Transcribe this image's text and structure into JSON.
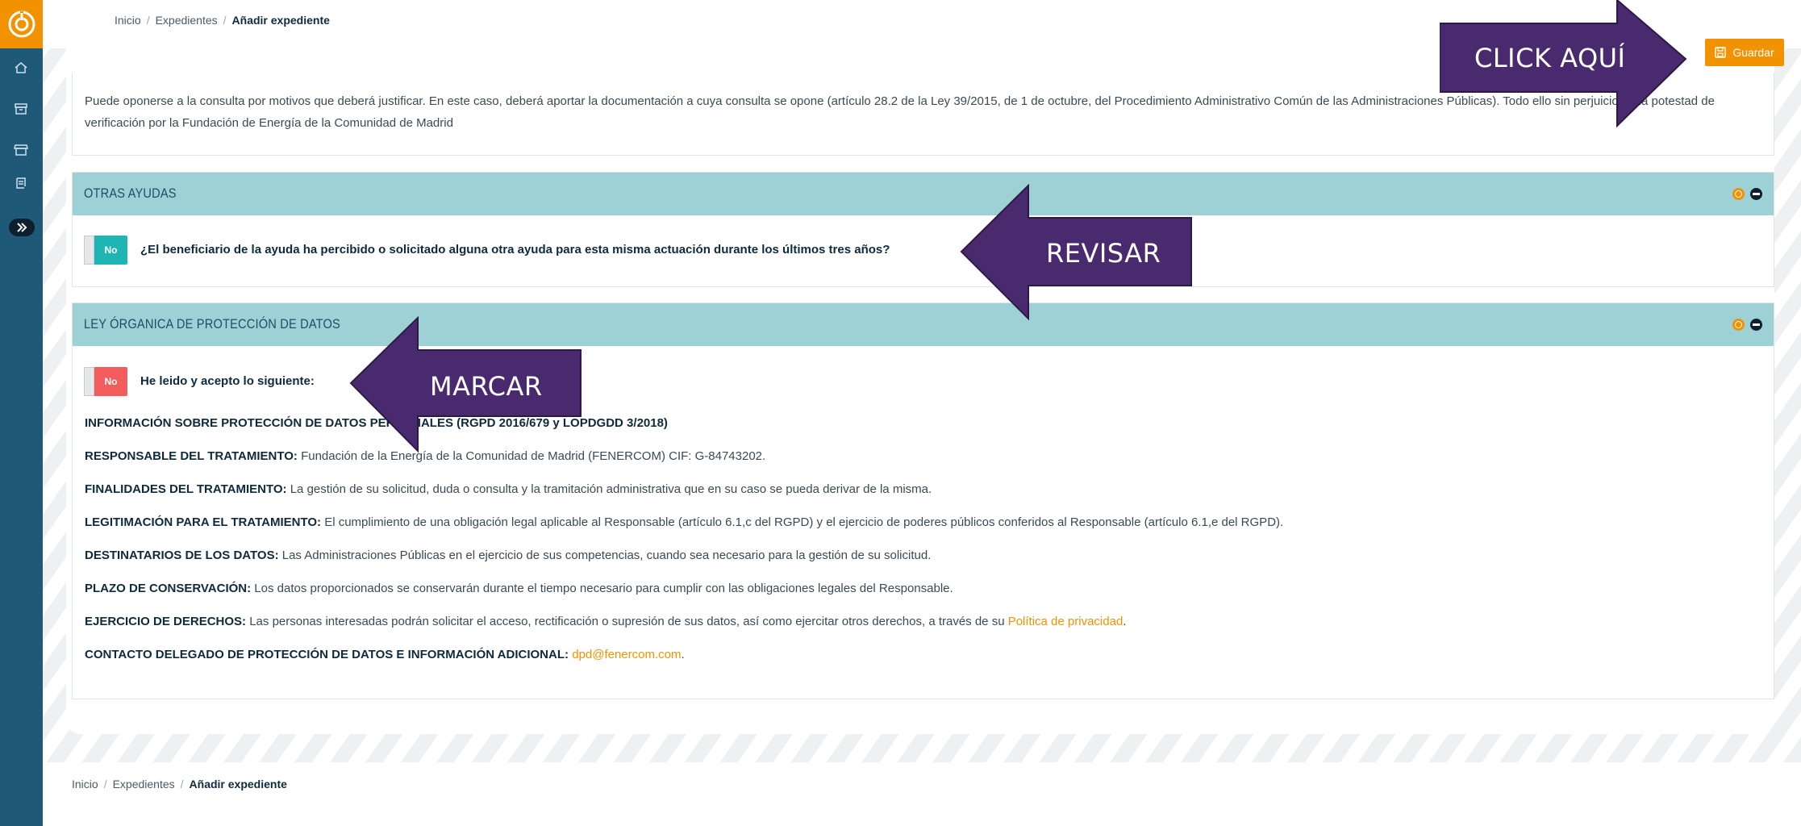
{
  "breadcrumb": {
    "home": "Inicio",
    "section": "Expedientes",
    "current": "Añadir expediente",
    "sep": "/"
  },
  "header": {
    "save_label": "Guardar"
  },
  "intro": {
    "text": "Puede oponerse a la consulta por motivos que deberá justificar. En este caso, deberá aportar la documentación a cuya consulta se opone (artículo 28.2 de la Ley 39/2015, de 1 de octubre, del Procedimiento Administrativo Común de las Administraciones Públicas). Todo ello sin perjuicio de la potestad de verificación por la Fundación de Energía de la Comunidad de Madrid"
  },
  "otras_ayudas": {
    "title": "OTRAS AYUDAS",
    "toggle_label": "No",
    "question": "¿El beneficiario de la ayuda ha percibido o solicitado alguna otra ayuda para esta misma actuación durante los últimos tres años?"
  },
  "lopd": {
    "title": "LEY ÓRGANICA DE PROTECCIÓN DE DATOS",
    "toggle_label": "No",
    "accept_text": "He leido y acepto lo siguiente:",
    "info_title": "INFORMACIÓN SOBRE PROTECCIÓN DE DATOS PERSONALES (RGPD 2016/679 y LOPDGDD 3/2018)",
    "lines": [
      {
        "label": "RESPONSABLE DEL TRATAMIENTO:",
        "text": " Fundación de la Energía de la Comunidad de Madrid (FENERCOM) CIF: G-84743202."
      },
      {
        "label": "FINALIDADES DEL TRATAMIENTO:",
        "text": " La gestión de su solicitud, duda o consulta y la tramitación administrativa que en su caso se pueda derivar de la misma."
      },
      {
        "label": "LEGITIMACIÓN PARA EL TRATAMIENTO:",
        "text": " El cumplimiento de una obligación legal aplicable al Responsable (artículo 6.1,c del RGPD) y el ejercicio de poderes públicos conferidos al Responsable (artículo 6.1,e del RGPD)."
      },
      {
        "label": "DESTINATARIOS DE LOS DATOS:",
        "text": " Las Administraciones Públicas en el ejercicio de sus competencias, cuando sea necesario para la gestión de su solicitud."
      },
      {
        "label": "PLAZO DE CONSERVACIÓN:",
        "text": " Los datos proporcionados se conservarán durante el tiempo necesario para cumplir con las obligaciones legales del Responsable."
      }
    ],
    "derechos": {
      "label": "EJERCICIO DE DERECHOS:",
      "text": " Las personas interesadas podrán solicitar el acceso, rectificación o supresión de sus datos, así como ejercitar otros derechos, a través de su ",
      "link": "Política de privacidad",
      "end": "."
    },
    "contacto": {
      "label": "CONTACTO DELEGADO DE PROTECCIÓN DE DATOS E INFORMACIÓN ADICIONAL:",
      "link": "dpd@fenercom.com",
      "end": "."
    }
  },
  "annotations": {
    "click": "CLICK AQUÍ",
    "revisar": "REVISAR",
    "marcar": "MARCAR"
  },
  "colors": {
    "accent": "#f39200",
    "sidebar": "#1e5a78",
    "panel_head": "#9dd1d6",
    "arrow": "#4a2a6e"
  }
}
